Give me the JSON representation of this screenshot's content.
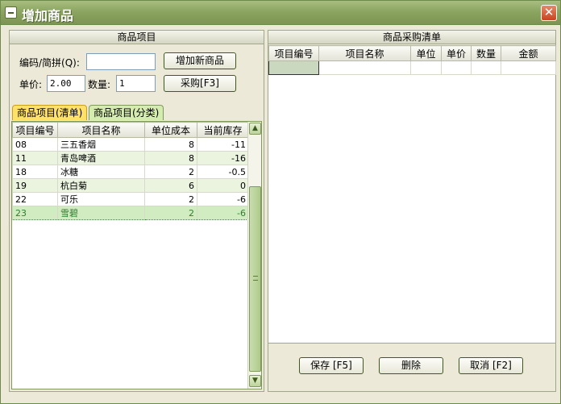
{
  "window": {
    "title": "增加商品",
    "close_glyph": "✕"
  },
  "left": {
    "header": "商品项目",
    "code_label": "编码/简拼(Q):",
    "code_value": "",
    "add_new_button": "增加新商品",
    "price_label": "单价:",
    "price_value": "2.00",
    "qty_label": "数量:",
    "qty_value": "1",
    "purchase_button": "采购[F3]",
    "tabs": [
      "商品项目(清单)",
      "商品项目(分类)"
    ],
    "columns": [
      "项目编号",
      "项目名称",
      "单位成本",
      "当前库存"
    ],
    "rows": [
      {
        "code": "08",
        "name": "三五香烟",
        "cost": "8",
        "stock": "-11"
      },
      {
        "code": "11",
        "name": "青岛啤酒",
        "cost": "8",
        "stock": "-16"
      },
      {
        "code": "18",
        "name": "冰糖",
        "cost": "2",
        "stock": "-0.5"
      },
      {
        "code": "19",
        "name": "杭白菊",
        "cost": "6",
        "stock": "0"
      },
      {
        "code": "22",
        "name": "可乐",
        "cost": "2",
        "stock": "-6"
      },
      {
        "code": "23",
        "name": "雪碧",
        "cost": "2",
        "stock": "-6"
      }
    ]
  },
  "right": {
    "header": "商品采购清单",
    "columns": [
      "项目编号",
      "项目名称",
      "单位",
      "单价",
      "数量",
      "金额"
    ],
    "save_button": "保存 [F5]",
    "delete_button": "删除",
    "cancel_button": "取消 [F2]"
  }
}
